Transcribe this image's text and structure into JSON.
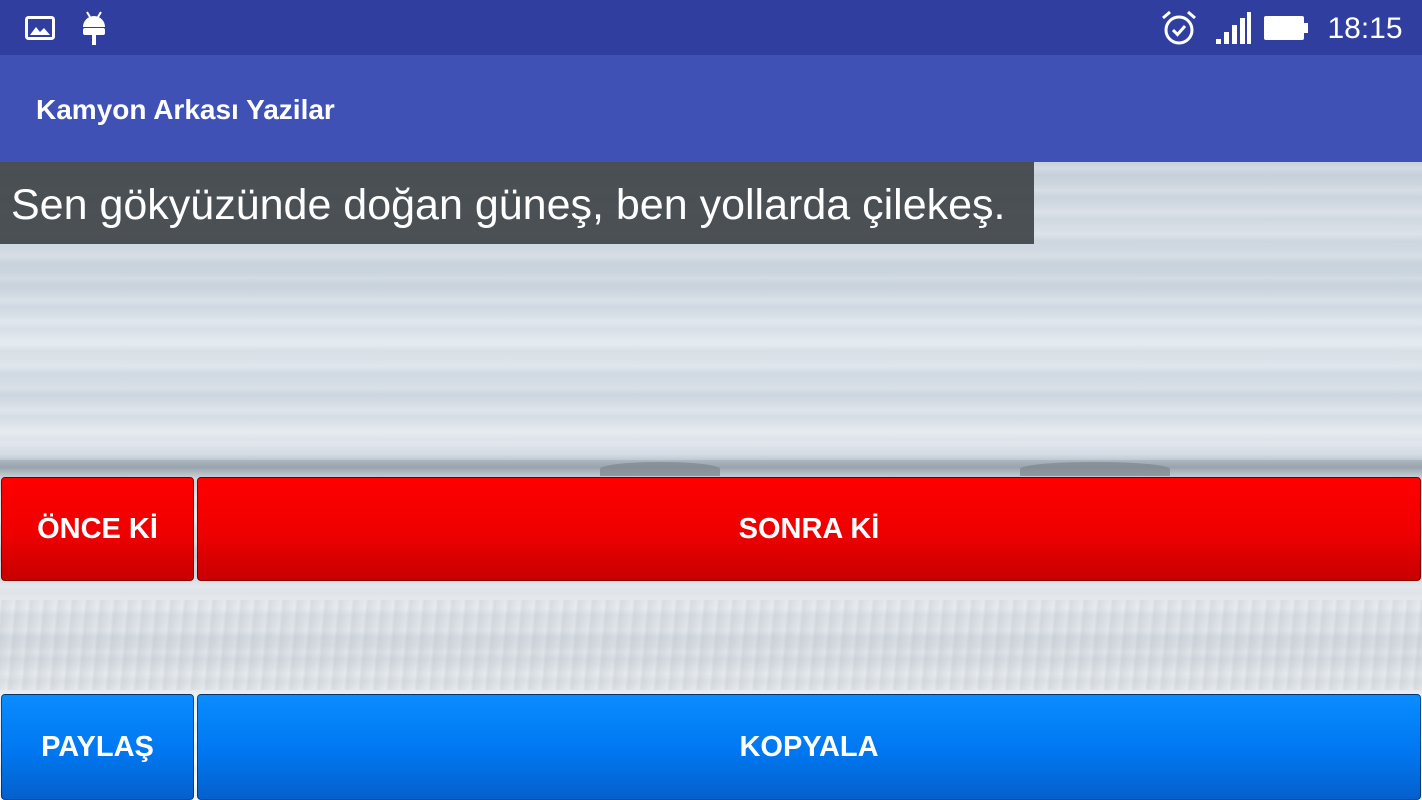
{
  "status_bar": {
    "time": "18:15",
    "left_icons": [
      "gallery-icon",
      "android-icon"
    ],
    "right_icons": [
      "alarm-icon",
      "signal-icon",
      "battery-icon"
    ],
    "background_color": "#303f9f"
  },
  "app_bar": {
    "title": "Kamyon Arkası Yazilar",
    "background_color": "#3f51b5"
  },
  "quote": {
    "text": "Sen gökyüzünde doğan güneş, ben yollarda çilekeş."
  },
  "buttons": {
    "prev_label": "ÖNCE Kİ",
    "next_label": "SONRA Kİ",
    "share_label": "PAYLAŞ",
    "copy_label": "KOPYALA"
  },
  "colors": {
    "nav_buttons": "#ee0000",
    "action_buttons": "#0077f0"
  }
}
